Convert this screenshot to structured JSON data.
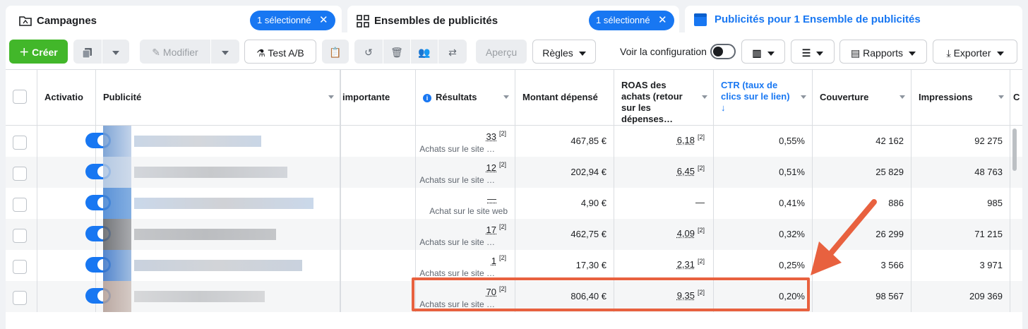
{
  "tabs": [
    {
      "title": "Campagnes",
      "pill": "1 sélectionné",
      "icon": "folder-icon"
    },
    {
      "title": "Ensembles de publicités",
      "pill": "1 sélectionné",
      "icon": "grid-icon"
    },
    {
      "title": "Publicités pour 1 Ensemble de publicités",
      "icon": "ad-icon"
    }
  ],
  "toolbar": {
    "create": "Créer",
    "modify": "Modifier",
    "ab_test": "Test A/B",
    "preview": "Aperçu",
    "rules": "Règles",
    "view_config": "Voir la configuration",
    "reports": "Rapports",
    "export": "Exporter"
  },
  "headers": {
    "activation": "Activatio",
    "ad": "Publicité",
    "important": "importante",
    "results": "Résultats",
    "spent": "Montant dépensé",
    "roas": "ROAS des achats (retour sur les dépenses…",
    "ctr": "CTR (taux de clics sur le lien) ↓",
    "reach": "Couverture",
    "impressions": "Impressions",
    "next": "C"
  },
  "rows": [
    {
      "results": "33",
      "results_ref": "[2]",
      "results_sub": "Achats sur le site …",
      "spent": "467,85 €",
      "roas": "6,18",
      "roas_ref": "[2]",
      "ctr": "0,55%",
      "reach": "42 162",
      "impressions": "92 275"
    },
    {
      "results": "12",
      "results_ref": "[2]",
      "results_sub": "Achats sur le site …",
      "spent": "202,94 €",
      "roas": "6,45",
      "roas_ref": "[2]",
      "ctr": "0,51%",
      "reach": "25 829",
      "impressions": "48 763"
    },
    {
      "results": "—",
      "results_ref": "",
      "results_sub": "Achat sur le site web",
      "spent": "4,90 €",
      "roas": "—",
      "roas_ref": "",
      "ctr": "0,41%",
      "reach": "886",
      "impressions": "985"
    },
    {
      "results": "17",
      "results_ref": "[2]",
      "results_sub": "Achats sur le site …",
      "spent": "462,75 €",
      "roas": "4,09",
      "roas_ref": "[2]",
      "ctr": "0,32%",
      "reach": "26 299",
      "impressions": "71 215"
    },
    {
      "results": "1",
      "results_ref": "[2]",
      "results_sub": "Achats sur le site …",
      "spent": "17,30 €",
      "roas": "2,31",
      "roas_ref": "[2]",
      "ctr": "0,25%",
      "reach": "3 566",
      "impressions": "3 971"
    },
    {
      "results": "70",
      "results_ref": "[2]",
      "results_sub": "Achats sur le site …",
      "spent": "806,40 €",
      "roas": "9,35",
      "roas_ref": "[2]",
      "ctr": "0,20%",
      "reach": "98 567",
      "impressions": "209 369"
    }
  ],
  "colors": {
    "accent": "#1877f2",
    "create": "#42b72a",
    "highlight": "#e8613f"
  }
}
